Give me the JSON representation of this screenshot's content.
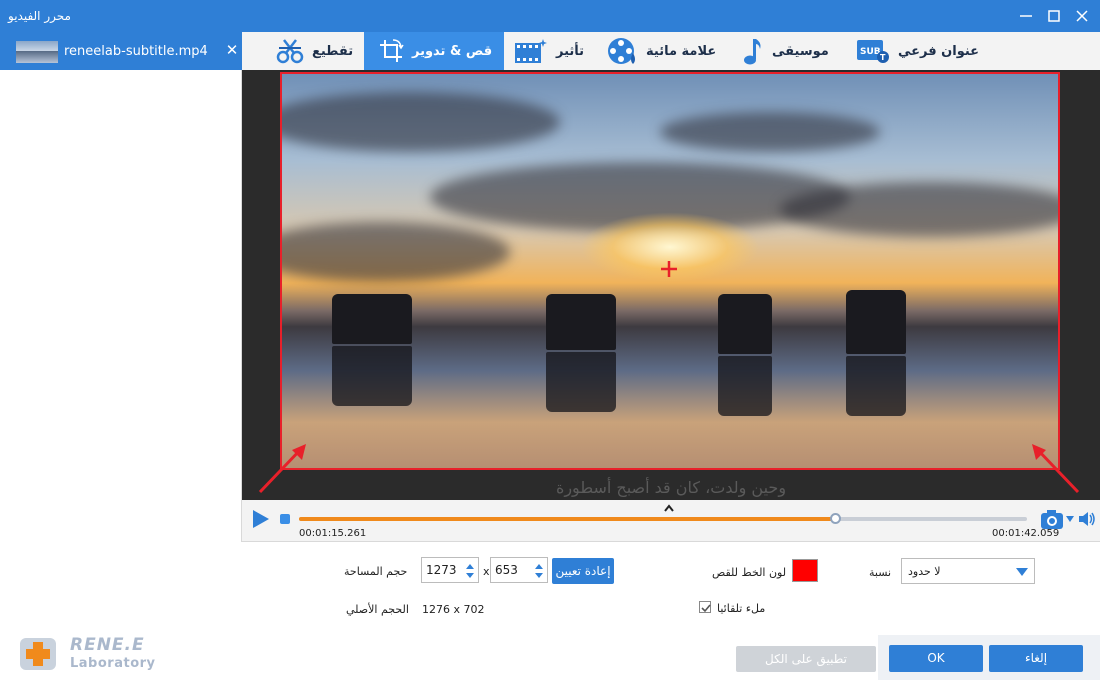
{
  "window": {
    "title": "محرر الفيديو"
  },
  "file_tab": {
    "filename": "reneelab-subtitle.mp4",
    "close_glyph": "✕"
  },
  "toolbar": {
    "tools": [
      {
        "label": "عنوان فرعي",
        "icon": "subtitle-icon"
      },
      {
        "label": "موسيقى",
        "icon": "music-note-icon"
      },
      {
        "label": "علامة مائية",
        "icon": "film-reel-icon"
      },
      {
        "label": "تأثير",
        "icon": "film-effect-icon"
      },
      {
        "label": "قص & تدوير",
        "icon": "crop-rotate-icon",
        "active": true
      },
      {
        "label": "تقطيع",
        "icon": "scissors-icon"
      }
    ]
  },
  "preview": {
    "subtitle_text": "وحين ولدت، كان قد أصبح أسطورة"
  },
  "playback": {
    "current_time": "00:01:15.261",
    "total_time": "00:01:42.059",
    "progress_fraction": 0.7373
  },
  "crop": {
    "area_size_label": "حجم المساحة",
    "width_value": "1273",
    "height_value": "653",
    "times_glyph": "x",
    "reset_label": "إعادة تعيين",
    "original_size_label": "الحجم الأصلي",
    "original_size_value": "1276 x 702",
    "line_color_label": "لون الخط للقص",
    "line_color": "#ff0000",
    "ratio_label": "نسبة",
    "ratio_value": "لا حدود",
    "auto_fill_label": "ملء تلقائيا",
    "auto_fill_checked": true
  },
  "actions": {
    "apply_all_label": "تطبيق على الكل",
    "ok_label": "OK",
    "cancel_label": "إلغاء"
  },
  "logo": {
    "line1": "RENE.E",
    "line2": "Laboratory"
  },
  "colors": {
    "accent": "#2f7fd6",
    "progress": "#f08a1c",
    "crop_border": "#e8202a"
  }
}
